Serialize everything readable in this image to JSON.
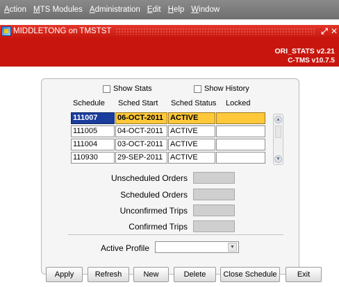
{
  "menu": {
    "items": [
      {
        "label": "Action",
        "underline": "A"
      },
      {
        "label": "MTS Modules",
        "underline": "M"
      },
      {
        "label": "Administration",
        "underline": "A"
      },
      {
        "label": "Edit",
        "underline": "E"
      },
      {
        "label": "Help",
        "underline": "H"
      },
      {
        "label": "Window",
        "underline": "W"
      }
    ]
  },
  "window": {
    "title": "MIDDLETONG on TMSTST",
    "controls": {
      "maximize": "⤢",
      "close": "✕"
    }
  },
  "banner": {
    "line1": "ORI_STATS v2.21",
    "line2": "C-TMS v10.7.5"
  },
  "options": {
    "show_stats": "Show Stats",
    "show_history": "Show History"
  },
  "grid": {
    "headers": [
      "Schedule",
      "Sched Start",
      "Sched Status",
      "Locked"
    ],
    "rows": [
      {
        "schedule": "111007",
        "start": "06-OCT-2011",
        "status": "ACTIVE",
        "locked": ""
      },
      {
        "schedule": "111005",
        "start": "04-OCT-2011",
        "status": "ACTIVE",
        "locked": ""
      },
      {
        "schedule": "111004",
        "start": "03-OCT-2011",
        "status": "ACTIVE",
        "locked": ""
      },
      {
        "schedule": "110930",
        "start": "29-SEP-2011",
        "status": "ACTIVE",
        "locked": ""
      }
    ]
  },
  "stats": {
    "unscheduled_orders": "Unscheduled Orders",
    "scheduled_orders": "Scheduled Orders",
    "unconfirmed_trips": "Unconfirmed Trips",
    "confirmed_trips": "Confirmed Trips"
  },
  "profile": {
    "label": "Active Profile",
    "value": ""
  },
  "buttons": {
    "apply": "Apply",
    "refresh": "Refresh",
    "new": "New",
    "delete": "Delete",
    "close_schedule": "Close Schedule",
    "exit": "Exit"
  },
  "colors": {
    "accent_red": "#c8160e",
    "selected_row": "#ffc83a",
    "selected_cell": "#1a3c9c",
    "menubar": "#7a7a7a"
  }
}
